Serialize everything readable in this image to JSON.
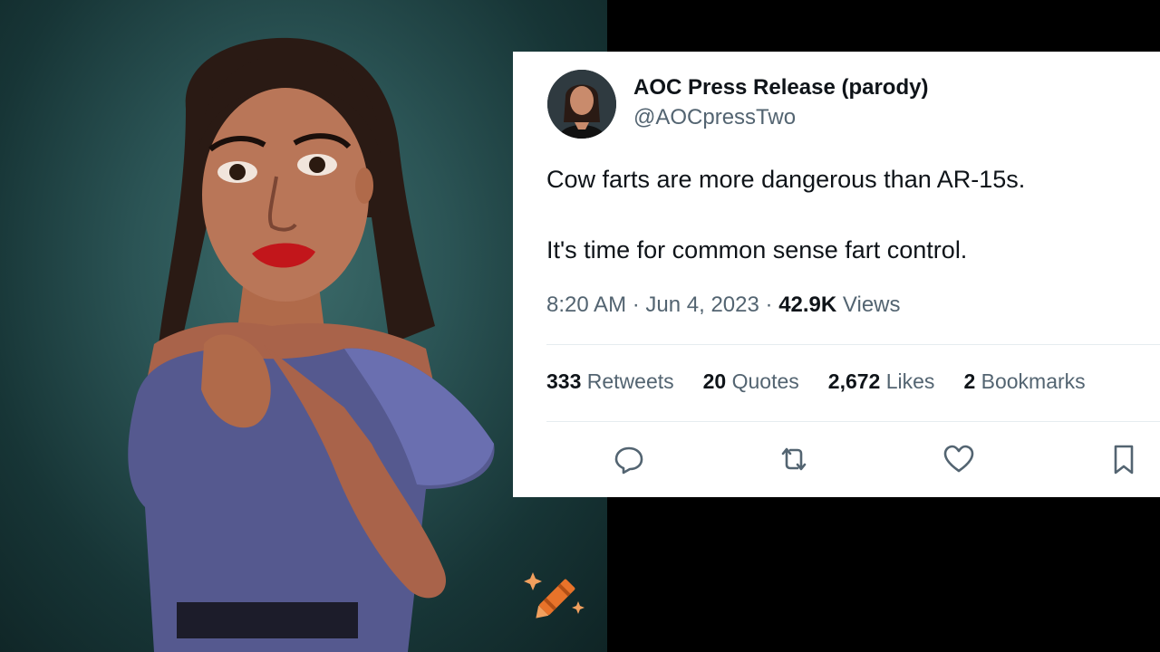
{
  "tweet": {
    "display_name": "AOC Press Release (parody)",
    "handle": "@AOCpressTwo",
    "text_line1": "Cow farts are more dangerous than AR-15s.",
    "text_line2": "It's time for common sense fart control.",
    "time": "8:20 AM",
    "date": "Jun 4, 2023",
    "views_count": "42.9K",
    "views_label": "Views",
    "stats": [
      {
        "count": "333",
        "label": "Retweets"
      },
      {
        "count": "20",
        "label": "Quotes"
      },
      {
        "count": "2,672",
        "label": "Likes"
      },
      {
        "count": "2",
        "label": "Bookmarks"
      }
    ],
    "actions": [
      "reply-icon",
      "retweet-icon",
      "like-icon",
      "bookmark-icon"
    ]
  },
  "colors": {
    "card_bg": "#ffffff",
    "primary_text": "#0f1419",
    "secondary_text": "#536471",
    "art_bg": "#2b5455",
    "dress": "#5a5f9c",
    "crayon": "#e8732a"
  }
}
